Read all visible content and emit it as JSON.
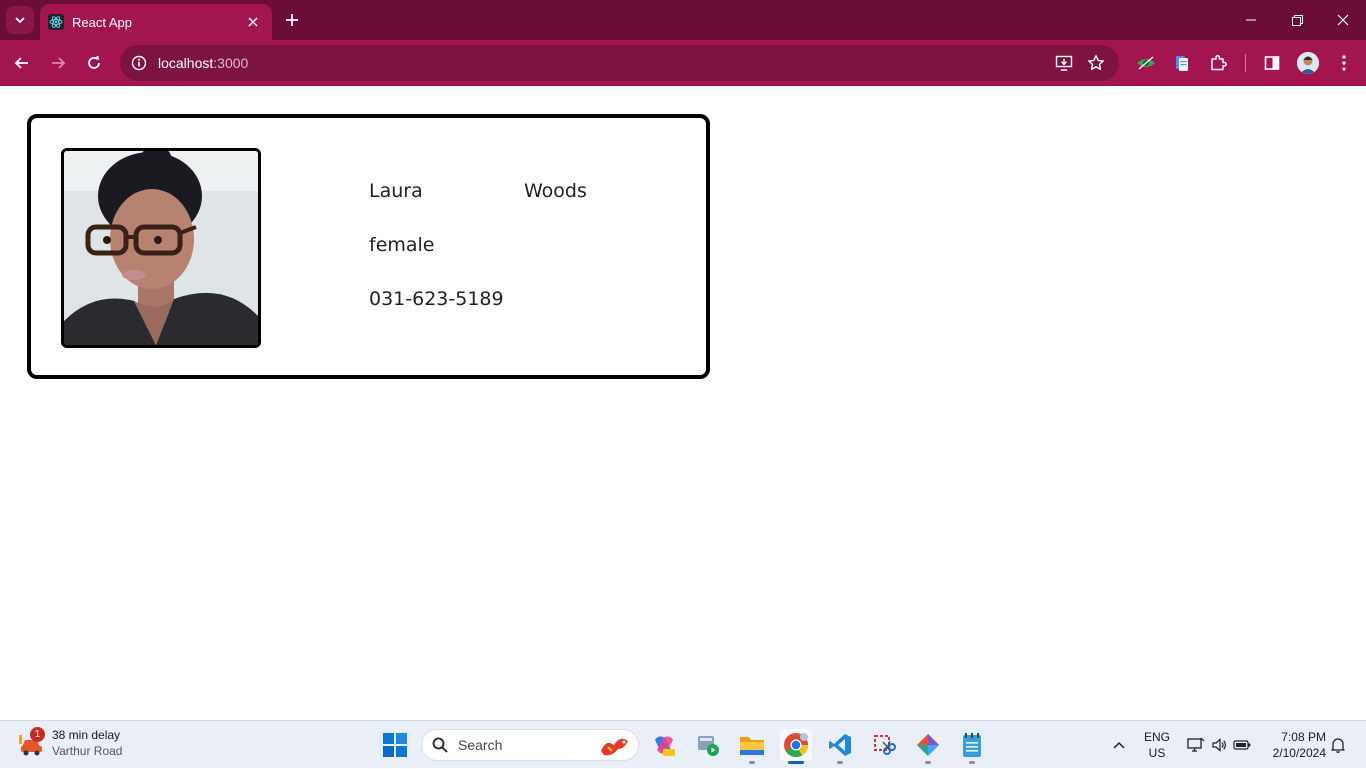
{
  "browser": {
    "tab_title": "React App",
    "url_host": "localhost",
    "url_port": ":3000"
  },
  "profile": {
    "first_name": "Laura",
    "last_name": "Woods",
    "gender": "female",
    "phone": "031-623-5189"
  },
  "taskbar": {
    "weather_badge": "1",
    "weather_title": "38 min delay",
    "weather_subtitle": "Varthur Road",
    "search_placeholder": "Search",
    "lang_primary": "ENG",
    "lang_secondary": "US",
    "time": "7:08 PM",
    "date": "2/10/2024"
  },
  "colors": {
    "tabstrip": "#6b0e36",
    "toolbar": "#a3154f",
    "card_border": "#000000"
  }
}
